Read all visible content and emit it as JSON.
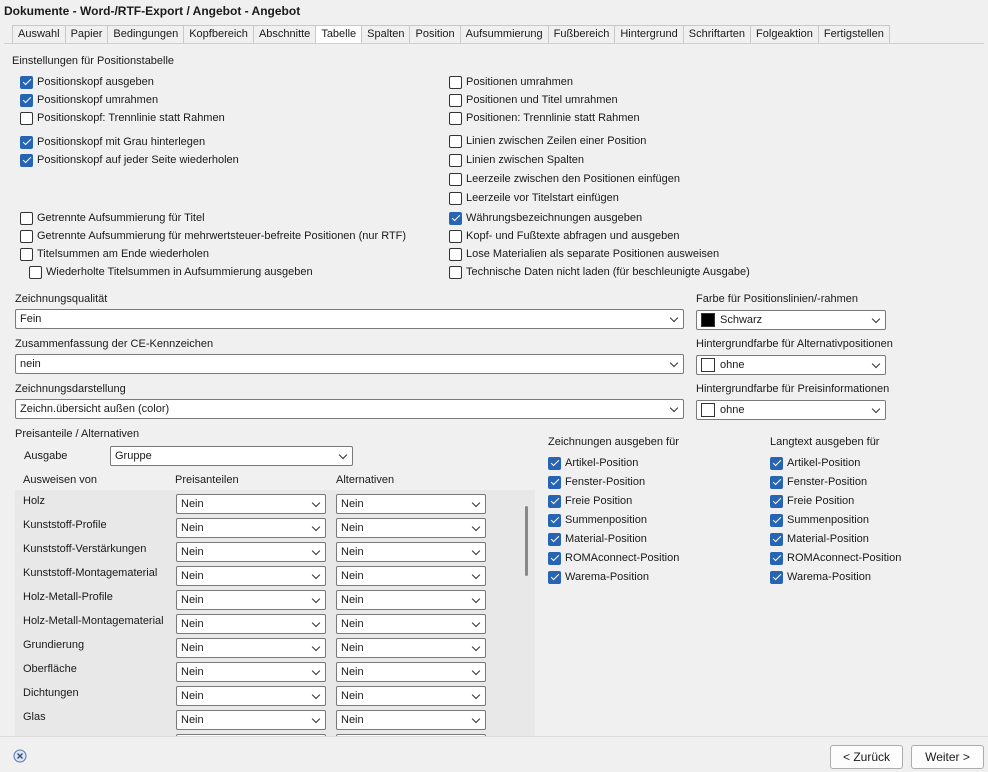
{
  "window": {
    "title": "Dokumente - Word-/RTF-Export  /  Angebot - Angebot"
  },
  "tabs": [
    "Auswahl",
    "Papier",
    "Bedingungen",
    "Kopfbereich",
    "Abschnitte",
    "Tabelle",
    "Spalten",
    "Position",
    "Aufsummierung",
    "Fußbereich",
    "Hintergrund",
    "Schriftarten",
    "Folgeaktion",
    "Fertigstellen"
  ],
  "active_tab": "Tabelle",
  "section_title": "Einstellungen für Positionstabelle",
  "left_checks": [
    {
      "label": "Positionskopf ausgeben",
      "checked": true
    },
    {
      "label": "Positionskopf umrahmen",
      "checked": true
    },
    {
      "label": "Positionskopf: Trennlinie statt Rahmen",
      "checked": false
    },
    {
      "label": "Positionskopf mit Grau hinterlegen",
      "checked": true
    },
    {
      "label": "Positionskopf auf jeder Seite wiederholen",
      "checked": true
    },
    {
      "label": "Getrennte Aufsummierung für Titel",
      "checked": false
    },
    {
      "label": "Getrennte Aufsummierung für mehrwertsteuer-befreite Positionen (nur RTF)",
      "checked": false
    },
    {
      "label": "Titelsummen am Ende wiederholen",
      "checked": false
    },
    {
      "label": "Wiederholte Titelsummen in Aufsummierung ausgeben",
      "checked": false
    }
  ],
  "right_checks": [
    {
      "label": "Positionen umrahmen",
      "checked": false
    },
    {
      "label": "Positionen und Titel umrahmen",
      "checked": false
    },
    {
      "label": "Positionen: Trennlinie statt Rahmen",
      "checked": false
    },
    {
      "label": "Linien zwischen Zeilen einer Position",
      "checked": false
    },
    {
      "label": "Linien zwischen Spalten",
      "checked": false
    },
    {
      "label": "Leerzeile zwischen den Positionen einfügen",
      "checked": false
    },
    {
      "label": "Leerzeile vor Titelstart einfügen",
      "checked": false
    },
    {
      "label": "Währungsbezeichnungen ausgeben",
      "checked": true
    },
    {
      "label": "Kopf- und Fußtexte abfragen und ausgeben",
      "checked": false
    },
    {
      "label": "Lose Materialien als separate Positionen ausweisen",
      "checked": false
    },
    {
      "label": "Technische Daten nicht laden (für beschleunigte Ausgabe)",
      "checked": false
    }
  ],
  "quality": {
    "label": "Zeichnungsqualität",
    "value": "Fein"
  },
  "ce": {
    "label": "Zusammenfassung der CE-Kennzeichen",
    "value": "nein"
  },
  "drawing_display": {
    "label": "Zeichnungsdarstellung",
    "value": "Zeichn.übersicht außen (color)"
  },
  "line_color": {
    "label": "Farbe für Positionslinien/-rahmen",
    "value": "Schwarz",
    "swatch": "#000000"
  },
  "alt_bg": {
    "label": "Hintergrundfarbe für Alternativpositionen",
    "value": "ohne",
    "swatch": "#ffffff"
  },
  "price_bg": {
    "label": "Hintergrundfarbe für Preisinformationen",
    "value": "ohne",
    "swatch": "#ffffff"
  },
  "price_section": {
    "title": "Preisanteile / Alternativen",
    "output_label": "Ausgabe",
    "output_value": "Gruppe",
    "col_ausweisen": "Ausweisen von",
    "col_preis": "Preisanteilen",
    "col_alt": "Alternativen",
    "rows": [
      {
        "name": "Holz",
        "preis": "Nein",
        "alt": "Nein"
      },
      {
        "name": "Kunststoff-Profile",
        "preis": "Nein",
        "alt": "Nein"
      },
      {
        "name": "Kunststoff-Verstärkungen",
        "preis": "Nein",
        "alt": "Nein"
      },
      {
        "name": "Kunststoff-Montagematerial",
        "preis": "Nein",
        "alt": "Nein"
      },
      {
        "name": "Holz-Metall-Profile",
        "preis": "Nein",
        "alt": "Nein"
      },
      {
        "name": "Holz-Metall-Montagematerial",
        "preis": "Nein",
        "alt": "Nein"
      },
      {
        "name": "Grundierung",
        "preis": "Nein",
        "alt": "Nein"
      },
      {
        "name": "Oberfläche",
        "preis": "Nein",
        "alt": "Nein"
      },
      {
        "name": "Dichtungen",
        "preis": "Nein",
        "alt": "Nein"
      },
      {
        "name": "Glas",
        "preis": "Nein",
        "alt": "Nein"
      }
    ]
  },
  "drawings_for": {
    "title": "Zeichnungen ausgeben für",
    "items": [
      {
        "label": "Artikel-Position",
        "checked": true
      },
      {
        "label": "Fenster-Position",
        "checked": true
      },
      {
        "label": "Freie Position",
        "checked": true
      },
      {
        "label": "Summenposition",
        "checked": true
      },
      {
        "label": "Material-Position",
        "checked": true
      },
      {
        "label": "ROMAconnect-Position",
        "checked": true
      },
      {
        "label": "Warema-Position",
        "checked": true
      }
    ]
  },
  "longtext_for": {
    "title": "Langtext ausgeben für",
    "items": [
      {
        "label": "Artikel-Position",
        "checked": true
      },
      {
        "label": "Fenster-Position",
        "checked": true
      },
      {
        "label": "Freie Position",
        "checked": true
      },
      {
        "label": "Summenposition",
        "checked": true
      },
      {
        "label": "Material-Position",
        "checked": true
      },
      {
        "label": "ROMAconnect-Position",
        "checked": true
      },
      {
        "label": "Warema-Position",
        "checked": true
      }
    ]
  },
  "footer": {
    "back_label": "< Zurück",
    "next_label": "Weiter >"
  }
}
